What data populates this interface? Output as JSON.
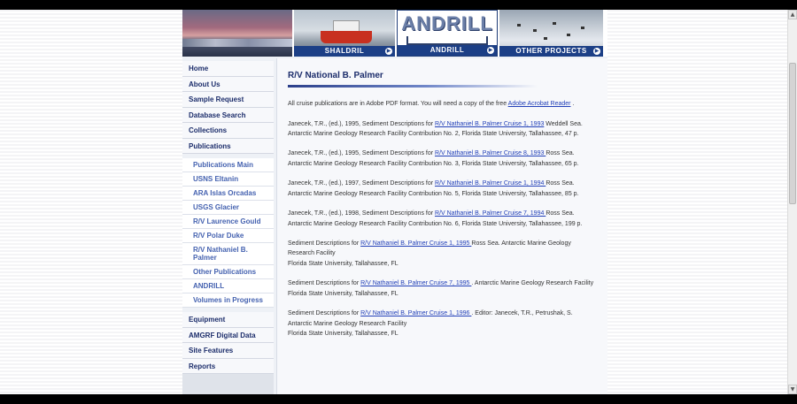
{
  "banner": {
    "tiles": [
      {
        "label": ""
      },
      {
        "label": "SHALDRIL"
      },
      {
        "label": "ANDRILL",
        "logo": "ANDRILL"
      },
      {
        "label": "OTHER PROJECTS"
      }
    ]
  },
  "sidebar": {
    "items": [
      {
        "label": "Home"
      },
      {
        "label": "About Us"
      },
      {
        "label": "Sample Request"
      },
      {
        "label": "Database Search"
      },
      {
        "label": "Collections"
      },
      {
        "label": "Publications"
      }
    ],
    "subitems": [
      {
        "label": "Publications Main"
      },
      {
        "label": "USNS Eltanin"
      },
      {
        "label": "ARA Islas Orcadas"
      },
      {
        "label": "USGS Glacier"
      },
      {
        "label": "R/V Laurence Gould"
      },
      {
        "label": "R/V Polar Duke"
      },
      {
        "label": "R/V Nathaniel B. Palmer"
      },
      {
        "label": "Other Publications"
      },
      {
        "label": "ANDRILL"
      },
      {
        "label": "Volumes in Progress"
      }
    ],
    "bottom_items": [
      {
        "label": "Equipment"
      },
      {
        "label": "AMGRF Digital Data"
      },
      {
        "label": "Site Features"
      },
      {
        "label": "Reports"
      }
    ]
  },
  "main": {
    "title": "R/V National B. Palmer",
    "intro": {
      "text": "All cruise publications are in Adobe PDF format. You will need a copy of the free ",
      "link": "Adobe Acrobat Reader",
      "suffix": " ."
    },
    "publications": [
      {
        "pre": "Janecek, T.R., (ed.), 1995, Sediment Descriptions for ",
        "link": "R/V Nathaniel B. Palmer Cruise 1, 1993",
        "post": " Weddell Sea. Antarctic Marine Geology Research Facility Contribution No. 2, Florida State University, Tallahassee, 47 p."
      },
      {
        "pre": "Janecek, T.R., (ed.), 1995, Sediment Descriptions for ",
        "link": "R/V Nathaniel B. Palmer Cruise 8, 1993 ",
        "post": "Ross Sea. Antarctic Marine Geology Research Facility Contribution No. 3, Florida State University, Tallahassee, 65 p."
      },
      {
        "pre": "Janecek, T.R., (ed.), 1997, Sediment Descriptions for ",
        "link": "R/V Nathaniel B. Palmer Cruise 1, 1994 ",
        "post": "Ross Sea. Antarctic Marine Geology Research Facility Contribution No. 5, Florida State University, Tallahassee, 85 p."
      },
      {
        "pre": "Janecek, T.R., (ed.), 1998, Sediment Descriptions for ",
        "link": "R/V Nathaniel B. Palmer Cruise 7, 1994 ",
        "post": "Ross Sea. Antarctic Marine Geology Research Facility Contribution No. 6, Florida State University, Tallahassee, 199 p."
      },
      {
        "pre": "Sediment Descriptions for ",
        "link": "R/V Nathaniel B. Palmer Cruise 1, 1995 ",
        "post": "Ross Sea. Antarctic Marine Geology Research Facility",
        "line2": "Florida State University, Tallahassee, FL"
      },
      {
        "pre": "Sediment Descriptions for ",
        "link": "R/V Nathaniel B. Palmer Cruise 7, 1995 ",
        "post": ". Antarctic Marine Geology Research Facility",
        "line2": "Florida State University, Tallahassee, FL"
      },
      {
        "pre": "Sediment Descriptions for ",
        "link": "R/V Nathaniel B. Palmer Cruise 1, 1996 ",
        "post": ". Editor: Janecek, T.R., Petrushak, S. Antarctic Marine Geology Research Facility",
        "line2": "Florida State University, Tallahassee, FL"
      }
    ]
  }
}
